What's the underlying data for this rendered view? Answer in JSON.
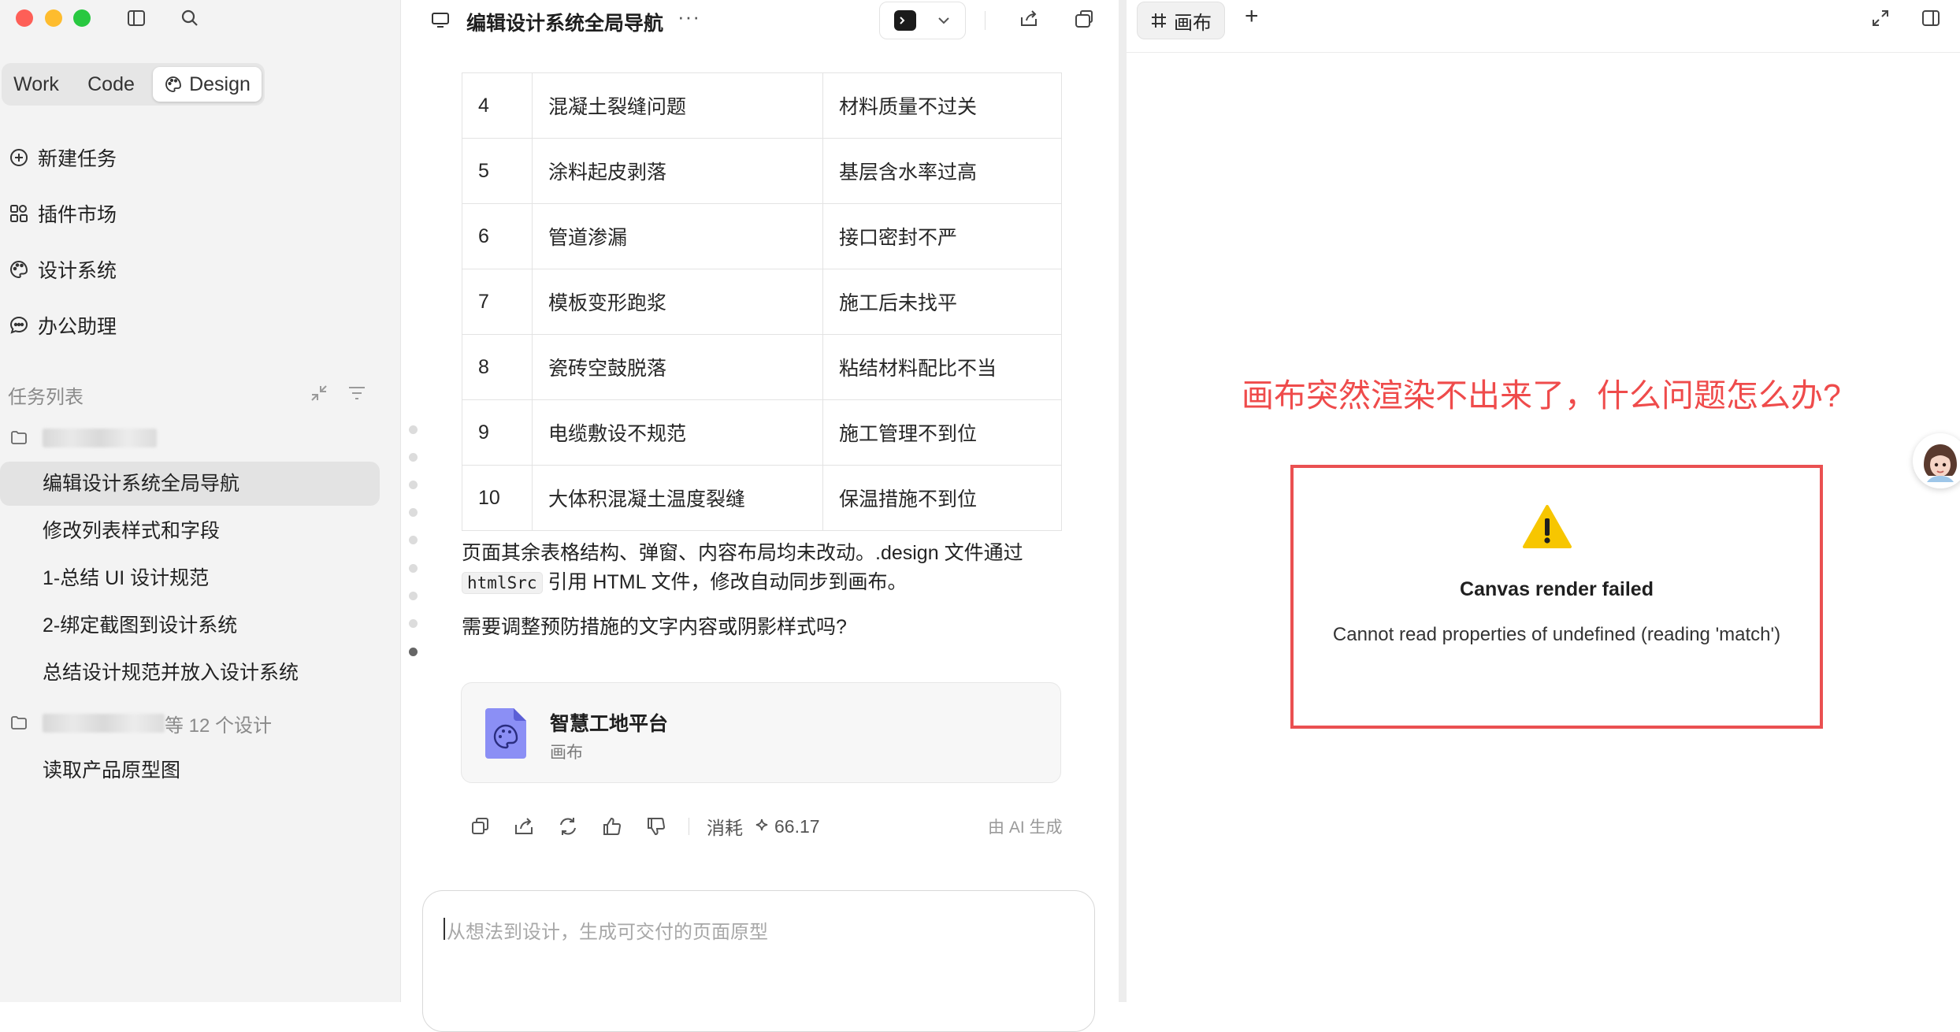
{
  "sidebar": {
    "modes": [
      "Work",
      "Code",
      "Design"
    ],
    "active_mode": "Design",
    "nav": [
      {
        "label": "新建任务",
        "icon": "plus-circle-icon"
      },
      {
        "label": "插件市场",
        "icon": "plugin-grid-icon"
      },
      {
        "label": "设计系统",
        "icon": "palette-icon"
      },
      {
        "label": "办公助理",
        "icon": "chat-bubble-icon"
      }
    ],
    "task_section_label": "任务列表",
    "folder_two_suffix": "等 12 个设计",
    "tasks_group_one": [
      "编辑设计系统全局导航",
      "修改列表样式和字段",
      "1-总结 UI 设计规范",
      "2-绑定截图到设计系统",
      "总结设计规范并放入设计系统"
    ],
    "tasks_group_two": [
      "读取产品原型图"
    ]
  },
  "header": {
    "title": "编辑设计系统全局导航",
    "more": "···"
  },
  "table": {
    "rows": [
      [
        "4",
        "混凝土裂缝问题",
        "材料质量不过关"
      ],
      [
        "5",
        "涂料起皮剥落",
        "基层含水率过高"
      ],
      [
        "6",
        "管道渗漏",
        "接口密封不严"
      ],
      [
        "7",
        "模板变形跑浆",
        "施工后未找平"
      ],
      [
        "8",
        "瓷砖空鼓脱落",
        "粘结材料配比不当"
      ],
      [
        "9",
        "电缆敷设不规范",
        "施工管理不到位"
      ],
      [
        "10",
        "大体积混凝土温度裂缝",
        "保温措施不到位"
      ]
    ]
  },
  "message": {
    "para1_a": "页面其余表格结构、弹窗、内容布局均未改动。.design 文件通过",
    "para1_code": "htmlSrc",
    "para1_b": "引用 HTML 文件，修改自动同步到画布。",
    "para2": "需要调整预防措施的文字内容或阴影样式吗?"
  },
  "file_card": {
    "title": "智慧工地平台",
    "subtitle": "画布"
  },
  "message_actions": {
    "consume_label": "消耗",
    "consume_value": "66.17",
    "ai_label": "由 AI 生成"
  },
  "input": {
    "placeholder": "从想法到设计，生成可交付的页面原型"
  },
  "canvas": {
    "tab_label": "画布",
    "add_tab": "+",
    "annotation": "画布突然渲染不出来了，什么问题怎么办?",
    "error_icon": "!",
    "error_title": "Canvas render failed",
    "error_message": "Cannot read properties of undefined (reading 'match')"
  },
  "colors": {
    "annotation_red": "#ef4b4b",
    "error_border": "#ea5051",
    "warning_yellow": "#f7c600",
    "file_icon_purple": "#8b8ff5"
  }
}
